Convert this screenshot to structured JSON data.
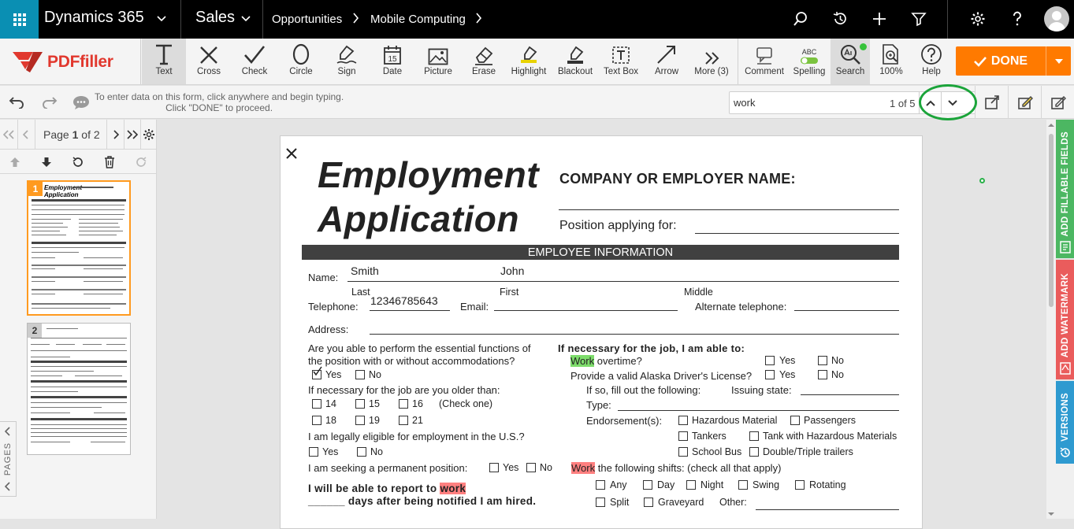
{
  "topnav": {
    "app_name": "Dynamics 365",
    "area": "Sales",
    "breadcrumb": [
      "Opportunities",
      "Mobile Computing"
    ]
  },
  "toolbar": {
    "brand": "PDFfiller",
    "tools": [
      {
        "label": "Text",
        "icon": "text-tool-icon",
        "active": true
      },
      {
        "label": "Cross",
        "icon": "cross-tool-icon"
      },
      {
        "label": "Check",
        "icon": "check-tool-icon"
      },
      {
        "label": "Circle",
        "icon": "circle-tool-icon"
      },
      {
        "label": "Sign",
        "icon": "sign-tool-icon"
      },
      {
        "label": "Date",
        "icon": "date-tool-icon"
      },
      {
        "label": "Picture",
        "icon": "picture-tool-icon"
      },
      {
        "label": "Erase",
        "icon": "erase-tool-icon"
      },
      {
        "label": "Highlight",
        "icon": "highlight-tool-icon"
      },
      {
        "label": "Blackout",
        "icon": "blackout-tool-icon"
      },
      {
        "label": "Text Box",
        "icon": "textbox-tool-icon"
      },
      {
        "label": "Arrow",
        "icon": "arrow-tool-icon"
      },
      {
        "label": "More (3)",
        "icon": "more-tool-icon"
      }
    ],
    "right_tools": [
      {
        "label": "Comment",
        "icon": "comment-icon"
      },
      {
        "label": "Spelling",
        "icon": "spelling-icon",
        "badge": "ABC"
      },
      {
        "label": "Search",
        "icon": "search-icon",
        "active": true
      },
      {
        "label": "100%",
        "icon": "zoom-icon"
      },
      {
        "label": "Help",
        "icon": "help-icon"
      }
    ],
    "done_label": "DONE",
    "accent_color": "#ff7a00"
  },
  "infobar": {
    "hint_line1": "To enter data on this form, click anywhere and begin typing.",
    "hint_line2": "Click \"DONE\" to proceed.",
    "search_value": "work",
    "search_count": "1 of 5"
  },
  "pager": {
    "page_word": "Page",
    "current": "1",
    "of_word": "of",
    "total": "2",
    "pages_tab": "PAGES",
    "thumbs": [
      "1",
      "2"
    ]
  },
  "side_tabs": {
    "fillable": "ADD FILLABLE FIELDS",
    "watermark": "ADD WATERMARK",
    "versions": "VERSIONS"
  },
  "document": {
    "title_line1": "Employment",
    "title_line2": "Application",
    "company_label": "COMPANY OR EMPLOYER NAME:",
    "position_label": "Position applying for:",
    "section_header": "EMPLOYEE INFORMATION",
    "name_label": "Name:",
    "last_value": "Smith",
    "first_value": "John",
    "last_label": "Last",
    "first_label": "First",
    "middle_label": "Middle",
    "telephone_label": "Telephone:",
    "telephone_value": "12346785643",
    "email_label": "Email:",
    "alt_phone_label": "Alternate telephone:",
    "address_label": "Address:",
    "q_functions_1": "Are you able to perform the essential functions of",
    "q_functions_2": "the position with or without accommodations?",
    "yes": "Yes",
    "no": "No",
    "q_older": "If necessary for the job are you older than:",
    "age_14": "14",
    "age_15": "15",
    "age_16": "16",
    "check_one": "(Check one)",
    "age_18": "18",
    "age_19": "19",
    "age_21": "21",
    "q_eligible": "I am legally eligible for employment in the U.S.?",
    "q_permanent": "I am seeking a permanent position:",
    "report_1a": "I will be able to report to",
    "report_work": "work",
    "report_2": "______ days after being notified I am hired.",
    "if_necessary": "If necessary for the job, I am able to:",
    "work_word": "Work",
    "overtime": "overtime?",
    "drivers": "Provide a valid Alaska Driver's License?",
    "if_so": "If so, fill out the following:",
    "issuing": "Issuing state:",
    "type": "Type:",
    "endorsements": "Endorsement(s):",
    "hazmat": "Hazardous Material",
    "passengers": "Passengers",
    "tankers": "Tankers",
    "tank_hazmat": "Tank with Hazardous Materials",
    "school_bus": "School Bus",
    "double_triple": "Double/Triple trailers",
    "work_word2": "Work",
    "shifts": "the following shifts: (check all that apply)",
    "any": "Any",
    "day": "Day",
    "night": "Night",
    "swing": "Swing",
    "rotating": "Rotating",
    "split": "Split",
    "graveyard": "Graveyard",
    "other": "Other:"
  }
}
